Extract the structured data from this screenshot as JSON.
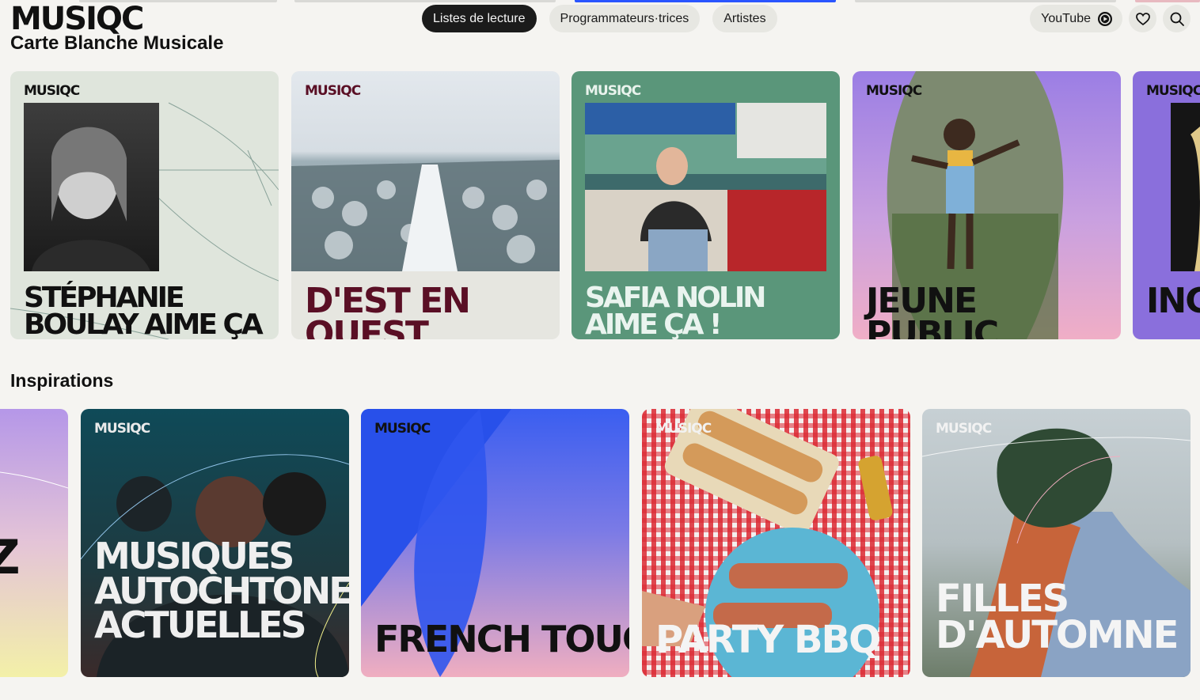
{
  "header": {
    "logo": "MUSIQC",
    "subtitle": "Carte Blanche Musicale",
    "nav": [
      "Listes de lecture",
      "Programmateurs·trices",
      "Artistes"
    ],
    "youtube_label": "YouTube"
  },
  "row1": {
    "brand": "MUSIQC",
    "cards": [
      {
        "title": "Stéphanie Boulay aime ça !"
      },
      {
        "title": "D'est en Ouest"
      },
      {
        "title": "Safia Nolin aime ça !"
      },
      {
        "title": "Jeune public"
      },
      {
        "title": "Ingri"
      }
    ]
  },
  "inspirations": {
    "title": "Inspirations",
    "brand": "MUSIQC",
    "cards": [
      {
        "title": "Z"
      },
      {
        "title": "Musiques autochtones actuelles"
      },
      {
        "title": "French touch !"
      },
      {
        "title": "Party BBQ"
      },
      {
        "title": "Filles d'automne"
      }
    ]
  },
  "colors": {
    "active_pill": "#1b1b1b",
    "pill": "#e7e7e2",
    "background": "#f5f4f1"
  },
  "icons": [
    "play-circle-icon",
    "heart-icon",
    "search-icon"
  ]
}
